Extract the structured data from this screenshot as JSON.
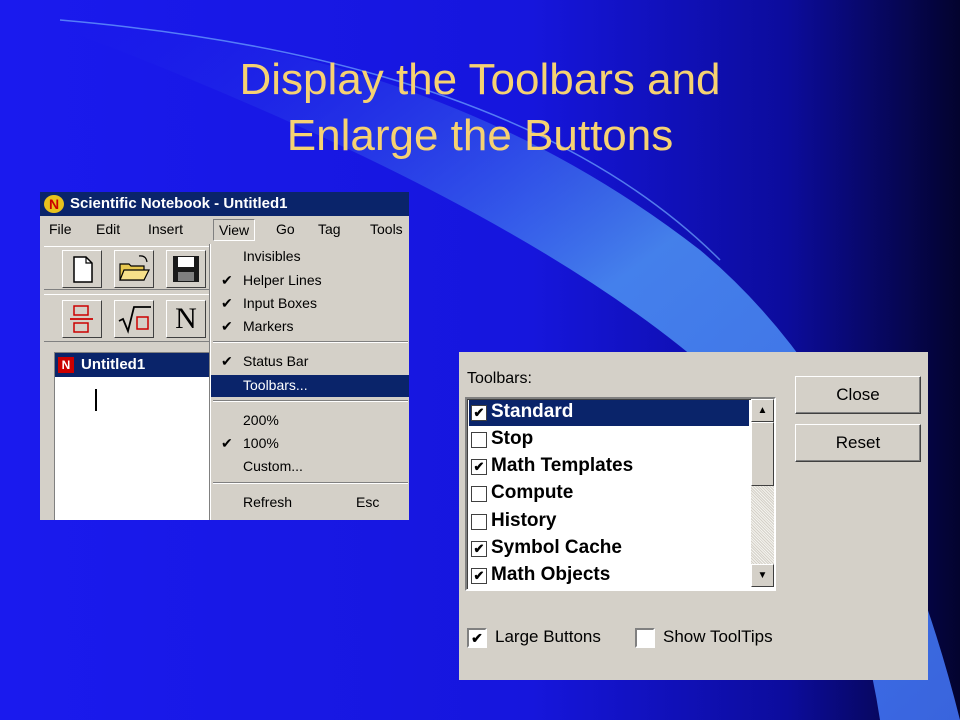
{
  "slide": {
    "title_line1": "Display the Toolbars and",
    "title_line2": "Enlarge the Buttons",
    "title_color": "#f6d272",
    "background_color": "#1a1aee"
  },
  "app_window": {
    "title": "Scientific Notebook - Untitled1",
    "menu": [
      "File",
      "Edit",
      "Insert",
      "View",
      "Go",
      "Tag",
      "Tools"
    ],
    "open_menu": "View",
    "toolbar1_icons": [
      "new-file-icon",
      "open-folder-icon",
      "save-disk-icon"
    ],
    "toolbar2_icons": [
      "fraction-icon",
      "radical-icon",
      "n-icon"
    ],
    "toolbar2_n_glyph": "N",
    "document_title": "Untitled1",
    "view_menu": [
      {
        "label": "Invisibles",
        "checked": false
      },
      {
        "label": "Helper Lines",
        "checked": true
      },
      {
        "label": "Input Boxes",
        "checked": true
      },
      {
        "label": "Markers",
        "checked": true
      },
      {
        "label": "Status Bar",
        "checked": true
      },
      {
        "label": "Toolbars...",
        "checked": false,
        "selected": true
      },
      {
        "label": "200%",
        "checked": false
      },
      {
        "label": "100%",
        "checked": true
      },
      {
        "label": "Custom...",
        "checked": false
      },
      {
        "label": "Refresh",
        "shortcut": "Esc",
        "checked": false
      }
    ],
    "check_glyph": "✔"
  },
  "toolbars_dialog": {
    "label": "Toolbars:",
    "items": [
      {
        "label": "Standard",
        "checked": true,
        "selected": true
      },
      {
        "label": "Stop",
        "checked": false
      },
      {
        "label": "Math Templates",
        "checked": true
      },
      {
        "label": "Compute",
        "checked": false
      },
      {
        "label": "History",
        "checked": false
      },
      {
        "label": "Symbol Cache",
        "checked": true
      },
      {
        "label": "Math Objects",
        "checked": true
      }
    ],
    "buttons": {
      "close": "Close",
      "reset": "Reset"
    },
    "large_buttons": {
      "label": "Large Buttons",
      "checked": true
    },
    "show_tooltips": {
      "label": "Show ToolTips",
      "checked": false
    },
    "checkbox_glyph": "✔"
  }
}
